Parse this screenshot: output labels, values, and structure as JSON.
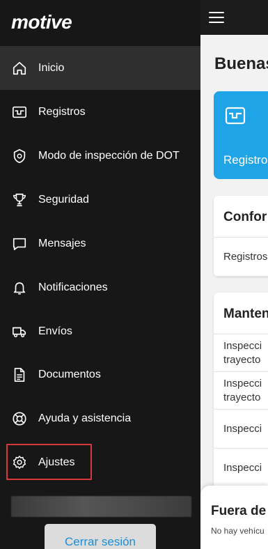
{
  "app": {
    "logo_text": "motive"
  },
  "drawer": {
    "items": [
      {
        "label": "Inicio",
        "icon": "home-icon",
        "active": true
      },
      {
        "label": "Registros",
        "icon": "logs-icon"
      },
      {
        "label": "Modo de inspección de DOT",
        "icon": "badge-icon"
      },
      {
        "label": "Seguridad",
        "icon": "trophy-icon"
      },
      {
        "label": "Mensajes",
        "icon": "chat-icon"
      },
      {
        "label": "Notificaciones",
        "icon": "bell-icon"
      },
      {
        "label": "Envíos",
        "icon": "truck-icon"
      },
      {
        "label": "Documentos",
        "icon": "document-icon"
      },
      {
        "label": "Ayuda y asistencia",
        "icon": "lifebuoy-icon"
      },
      {
        "label": "Ajustes",
        "icon": "gear-icon",
        "highlighted": true
      }
    ],
    "logout_label": "Cerrar sesión"
  },
  "main": {
    "menu_icon": "hamburger-icon",
    "greeting": "Buenas",
    "card": {
      "label": "Registros",
      "icon": "logs-icon"
    },
    "compliance": {
      "title": "Confor",
      "rows": [
        "Registros"
      ]
    },
    "maintenance": {
      "title": "Manten",
      "rows": [
        {
          "line1": "Inspecci",
          "line2": "trayecto"
        },
        {
          "line1": "Inspecci",
          "line2": "trayecto"
        },
        {
          "line1": "Inspecci"
        },
        {
          "line1": "Inspecci"
        }
      ]
    },
    "bottom_sheet": {
      "title": "Fuera de",
      "subtitle": "No hay vehícu"
    }
  },
  "colors": {
    "accent": "#1fa4e8",
    "drawer_bg": "#171717",
    "active_bg": "#2f2f2f",
    "highlight": "#d9363e",
    "link": "#1a8fd6"
  }
}
